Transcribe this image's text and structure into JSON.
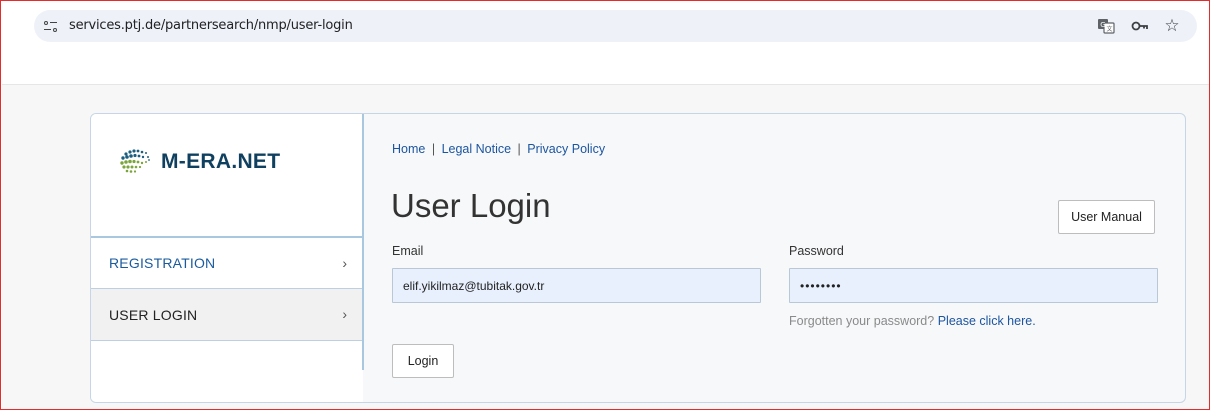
{
  "browser": {
    "url": "services.ptj.de/partnersearch/nmp/user-login"
  },
  "brand": {
    "logo_text": "M-ERA.NET"
  },
  "sidebar": {
    "items": [
      {
        "label": "REGISTRATION",
        "chevron": "›"
      },
      {
        "label": "USER LOGIN",
        "chevron": "›"
      }
    ]
  },
  "breadcrumb": {
    "home": "Home",
    "legal": "Legal Notice",
    "privacy": "Privacy Policy",
    "separator": "|"
  },
  "main": {
    "title": "User Login",
    "manual_label": "User Manual"
  },
  "form": {
    "email_label": "Email",
    "email_value": "elif.yikilmaz@tubitak.gov.tr",
    "password_label": "Password",
    "password_value": "••••••••",
    "forgot_text": "Forgotten your password?",
    "forgot_link": "Please click here.",
    "login_label": "Login"
  },
  "colors": {
    "frame_border": "#e52b2b",
    "link": "#1c55a0",
    "autofill_bg": "#e8f0fe",
    "brand_text": "#10405f"
  }
}
